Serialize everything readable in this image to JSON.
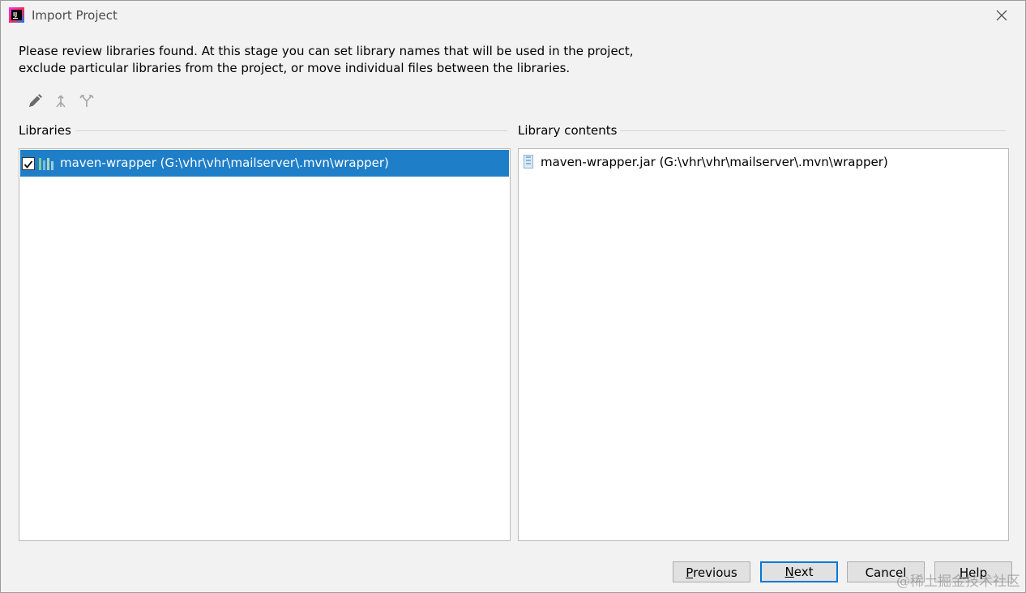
{
  "window": {
    "title": "Import Project",
    "accent_color": "#1e7ec8",
    "icon": "intellij-idea-icon"
  },
  "description": {
    "line1": "Please review libraries found. At this stage you can set library names that will be used in the project,",
    "line2": "exclude particular libraries from the project, or move individual files between the libraries."
  },
  "toolbar": {
    "tools": [
      {
        "icon": "pencil-icon",
        "name": "rename"
      },
      {
        "icon": "merge-icon",
        "name": "merge"
      },
      {
        "icon": "split-icon",
        "name": "split"
      }
    ]
  },
  "libraries": {
    "label": "Libraries",
    "items": [
      {
        "checked": true,
        "icon": "library-icon",
        "label": "maven-wrapper (G:\\vhr\\vhr\\mailserver\\.mvn\\wrapper)",
        "selected": true
      }
    ]
  },
  "library_contents": {
    "label": "Library contents",
    "items": [
      {
        "icon": "jar-icon",
        "label": "maven-wrapper.jar (G:\\vhr\\vhr\\mailserver\\.mvn\\wrapper)"
      }
    ]
  },
  "buttons": {
    "previous": {
      "mnemonic": "P",
      "rest": "revious"
    },
    "next": {
      "mnemonic": "N",
      "rest": "ext"
    },
    "cancel": "Cancel",
    "help": {
      "mnemonic": "H",
      "rest": "elp"
    }
  },
  "watermark": "@稀土掘金技术社区"
}
